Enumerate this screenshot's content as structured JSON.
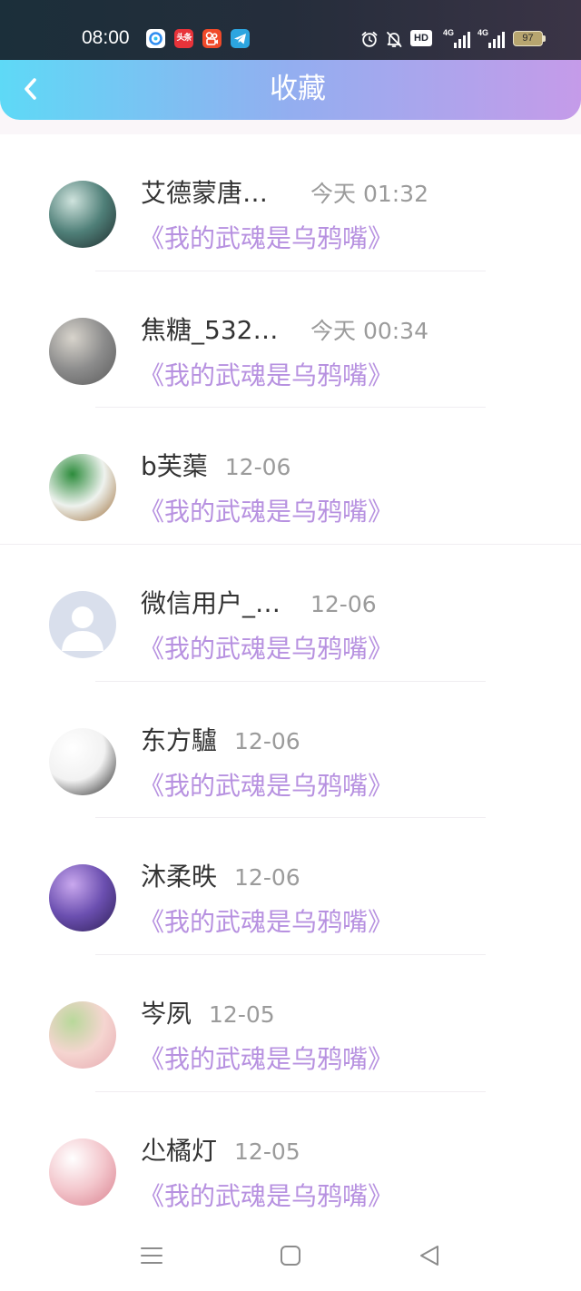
{
  "status_bar": {
    "time": "08:00",
    "app_icons": [
      {
        "icon": "browser-app-icon",
        "color": "#2f8df0"
      },
      {
        "icon": "toutiao-app-icon",
        "label": "头条",
        "color": "#e8333a"
      },
      {
        "icon": "kuaishou-app-icon",
        "color": "#f04a2a"
      },
      {
        "icon": "telegram-app-icon",
        "color": "#2ca5e0"
      }
    ],
    "alarm_icon": "alarm-clock-icon",
    "mute_icon": "bell-off-icon",
    "hd_label": "HD",
    "sim1_network": "4G",
    "sim2_network": "4G",
    "battery_level": "97"
  },
  "header": {
    "back_icon": "chevron-left-icon",
    "title": "收藏",
    "gradient": [
      "#5ed9f6",
      "#c59be9"
    ]
  },
  "favorites": [
    {
      "name": "艾德蒙唐…",
      "time": "今天 01:32",
      "book": "《我的武魂是乌鸦嘴》",
      "avatar_colors": [
        "#cfe3dd",
        "#4f7f78",
        "#1f2b2c"
      ]
    },
    {
      "name": "焦糖_532…",
      "time": "今天 00:34",
      "book": "《我的武魂是乌鸦嘴》",
      "avatar_colors": [
        "#d8d4cc",
        "#8c8c8c",
        "#5a5a5a"
      ]
    },
    {
      "name": "b芙蕖",
      "time": "12-06",
      "book": "《我的武魂是乌鸦嘴》",
      "avatar_colors": [
        "#2d8c3c",
        "#eef2ee",
        "#9b6b35"
      ]
    },
    {
      "name": "微信用户_…",
      "time": "12-06",
      "book": "《我的武魂是乌鸦嘴》",
      "avatar_colors": [
        "#d9dfec"
      ],
      "avatar_icon": "default-avatar-icon"
    },
    {
      "name": "东方驢",
      "time": "12-06",
      "book": "《我的武魂是乌鸦嘴》",
      "avatar_colors": [
        "#ffffff",
        "#f2f2f2",
        "#1e1e1e"
      ]
    },
    {
      "name": "沐柔昳",
      "time": "12-06",
      "book": "《我的武魂是乌鸦嘴》",
      "avatar_colors": [
        "#c9a8ee",
        "#6b4fb0",
        "#2e1f55"
      ]
    },
    {
      "name": "岑夙",
      "time": "12-05",
      "book": "《我的武魂是乌鸦嘴》",
      "avatar_colors": [
        "#b8d89a",
        "#f5d5d0",
        "#e6a9b0"
      ]
    },
    {
      "name": "尐橘灯",
      "time": "12-05",
      "book": "《我的武魂是乌鸦嘴》",
      "avatar_colors": [
        "#ffffff",
        "#f3c6cc",
        "#d9808e"
      ]
    }
  ],
  "nav_bar": {
    "menu_icon": "menu-icon",
    "home_icon": "square-home-icon",
    "back_icon": "triangle-back-icon"
  },
  "colors": {
    "name_text": "#333333",
    "time_text": "#9b9b9b",
    "book_text": "#b791e0"
  }
}
